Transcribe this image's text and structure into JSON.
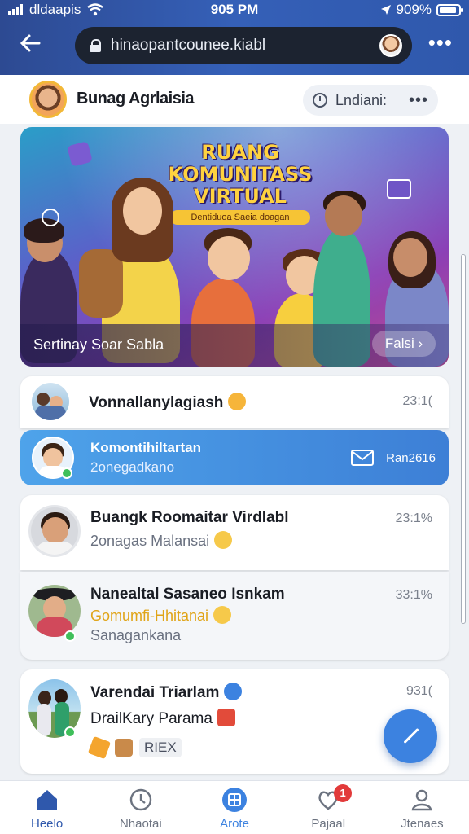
{
  "status_bar": {
    "carrier": "dldaapis",
    "time": "905 PM",
    "battery": "909%"
  },
  "browser": {
    "url": "hinaopantcounee.kiabl"
  },
  "profile": {
    "name": "Bunag Agrlaisia",
    "pill_label": "Lndiani:"
  },
  "banner": {
    "title_lines": [
      "RUANG",
      "KOMUNITASS",
      "VIRTUAL"
    ],
    "tagline": "Dentiduoa Saeia doagan",
    "caption": "Sertinay Soar Sabla",
    "cta": "Falsi ›"
  },
  "chats": [
    {
      "title": "Vonnallanylagiash",
      "time": "23:1("
    },
    {
      "title": "Komontihiltartan",
      "subtitle": "2onegadkano",
      "time": "Ran2616"
    },
    {
      "title": "Buangk Roomaitar Virdlabl",
      "subtitle": "2onagas Malansai",
      "time": "23:1%"
    },
    {
      "title": "Nanealtal Sasaneo Isnkam",
      "subtitle": "Gomumfi-Hhitanai",
      "subtitle2": "Sanagankana",
      "time": "33:1%"
    },
    {
      "title": "Varendai Triarlam",
      "subtitle": "DrailKary Parama",
      "tag": "RIEX",
      "time": "931("
    }
  ],
  "nav": [
    {
      "label": "Heelo"
    },
    {
      "label": "Nhaotai"
    },
    {
      "label": "Arote"
    },
    {
      "label": "Pajaal",
      "badge": "1"
    },
    {
      "label": "Jtenaes"
    }
  ],
  "colors": {
    "accent": "#3c82e0",
    "header": "#2f58ac",
    "badge": "#e23a3a"
  }
}
